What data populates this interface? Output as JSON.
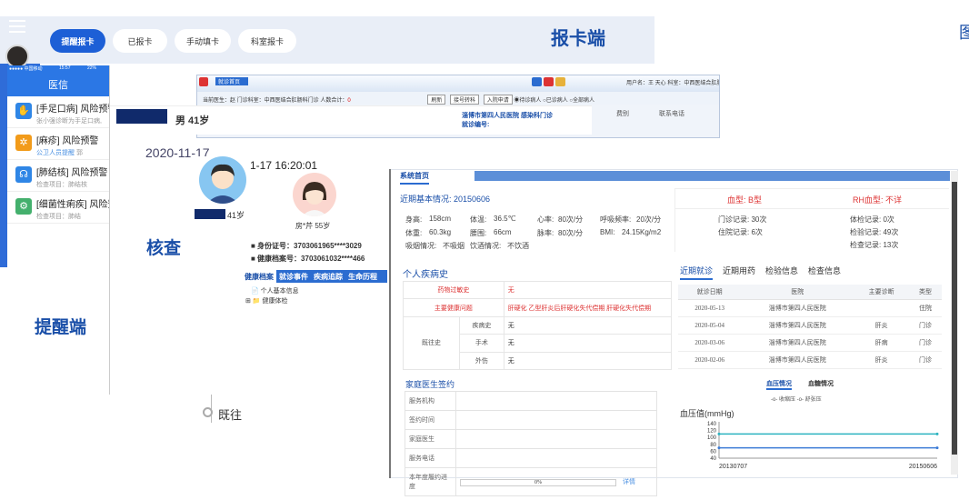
{
  "top": {
    "buttons": [
      "提醒报卡",
      "已报卡",
      "手动填卡",
      "科室报卡"
    ],
    "label": "报卡端",
    "right_glyph": "图"
  },
  "mobile": {
    "status_left": "●●●●● 中国移动",
    "status_time": "15:57",
    "status_right": "22%",
    "title": "医信",
    "items": [
      {
        "title": "[手足口病] 风险预警",
        "sub": "张小强诊断为手足口病,",
        "sub_hl": "",
        "color": "#2f86e6",
        "icon": "hand-icon"
      },
      {
        "title": "[麻疹] 风险预警",
        "sub": "公卫人员提醒",
        "sub_hl": "郭",
        "color": "#f29b1a",
        "icon": "gear-icon"
      },
      {
        "title": "[肺结核] 风险预警",
        "sub": "检查项目：肺结核",
        "sub_hl": "",
        "color": "#2f86e6",
        "icon": "lungs-icon"
      },
      {
        "title": "[细菌性痢疾] 风险预警",
        "sub": "检查项目：肺结",
        "sub_hl": "",
        "color": "#44b06d",
        "icon": "settings-icon"
      }
    ],
    "label": "提醒端"
  },
  "doc": {
    "tab": "就诊首页",
    "user": "用户名：王 天心  科室：中西医结合肛肠科门诊",
    "row2_left": "当前医生：赵    门诊科室：中西医结合肛肠科门诊   人数合计：",
    "row2_count": "0",
    "buttons": [
      "刷新",
      "接号转科",
      "入院申请"
    ],
    "radios": "◉待诊病人  ○已诊病人  ○全部病人",
    "hospital": "淄博市第四人民医院  感染科门诊",
    "visit_no": "就诊编号:",
    "fee": "费别",
    "contact": "联系电话"
  },
  "patient": {
    "line": "男  41岁"
  },
  "timeline": {
    "date_big": "2020-11-17",
    "items": [
      "2020",
      "2020",
      "2020",
      "既往"
    ],
    "label": "核查"
  },
  "archive": {
    "time": "1-17 16:20:01",
    "age1": "41岁",
    "name2": "房*芹   55岁",
    "id_no": "■ 身份证号：3703061965****3029",
    "rec_no": "■ 健康档案号：3703061032****466",
    "tabs": [
      "健康档案",
      "就诊事件",
      "疾病追踪",
      "生命历程"
    ],
    "tree1": "📄 个人基本信息",
    "tree2": "⊞ 📁 健康体检"
  },
  "health": {
    "tab": "系统首页",
    "basic_title": "近期基本情况: 20150606",
    "rows": [
      [
        "身高:",
        "158cm",
        "体温:",
        "36.5℃",
        "心率:",
        "80次/分",
        "呼吸频率:",
        "20次/分"
      ],
      [
        "体重:",
        "60.3kg",
        "腰围:",
        "66cm",
        "脉率:",
        "80次/分",
        "BMI:",
        "24.15Kg/m2"
      ],
      [
        "吸烟情况:",
        "不吸烟",
        "饮酒情况:",
        "不饮酒",
        "",
        "",
        "",
        ""
      ]
    ],
    "blood_type": "血型: B型",
    "rh": "RH血型: 不详",
    "counts_left": [
      "门诊记录: 30次",
      "住院记录: 6次"
    ],
    "counts_right": [
      "体检记录: 0次",
      "检验记录: 49次",
      "检查记录: 13次"
    ],
    "hist_title": "个人疾病史",
    "hist": {
      "drug_label": "药物过敏史",
      "drug_val": "无",
      "main_label": "主要健康问题",
      "main_val": "肝硬化 乙型肝炎后肝硬化失代偿期 肝硬化失代偿期",
      "past_label": "既往史",
      "past_rows": [
        [
          "疾病史",
          "无"
        ],
        [
          "手术",
          "无"
        ],
        [
          "外伤",
          "无"
        ]
      ]
    },
    "visit_tabs": [
      "近期就诊",
      "近期用药",
      "检验信息",
      "检查信息"
    ],
    "visit_headers": [
      "就诊日期",
      "医院",
      "主要诊断",
      "类型"
    ],
    "visits": [
      [
        "2020-05-13",
        "淄博市第四人民医院",
        "",
        "住院"
      ],
      [
        "2020-05-04",
        "淄博市第四人民医院",
        "肝炎",
        "门诊"
      ],
      [
        "2020-03-06",
        "淄博市第四人民医院",
        "肝病",
        "门诊"
      ],
      [
        "2020-02-06",
        "淄博市第四人民医院",
        "肝炎",
        "门诊"
      ]
    ],
    "fam_title": "家庭医生签约",
    "fam_rows": [
      "服务机构",
      "签约时间",
      "家庭医生",
      "服务电话"
    ],
    "fam_progress_label": "本年度履约进度",
    "fam_progress": "0%",
    "fam_link": "详情",
    "bp_tabs": [
      "血压情况",
      "血糖情况"
    ],
    "bp_legend": "-o- 收缩压  -o- 舒张压"
  },
  "chart_data": {
    "type": "line",
    "title": "",
    "ylabel": "血压值(mmHg)",
    "x": [
      "20130707",
      "20150606"
    ],
    "ylim": [
      40,
      140
    ],
    "yticks": [
      140,
      120,
      100,
      80,
      60,
      40
    ],
    "series": [
      {
        "name": "收缩压",
        "values": [
          110,
          110
        ],
        "color": "#2bb3c0"
      },
      {
        "name": "舒张压",
        "values": [
          70,
          70
        ],
        "color": "#3b7bd6"
      }
    ]
  }
}
